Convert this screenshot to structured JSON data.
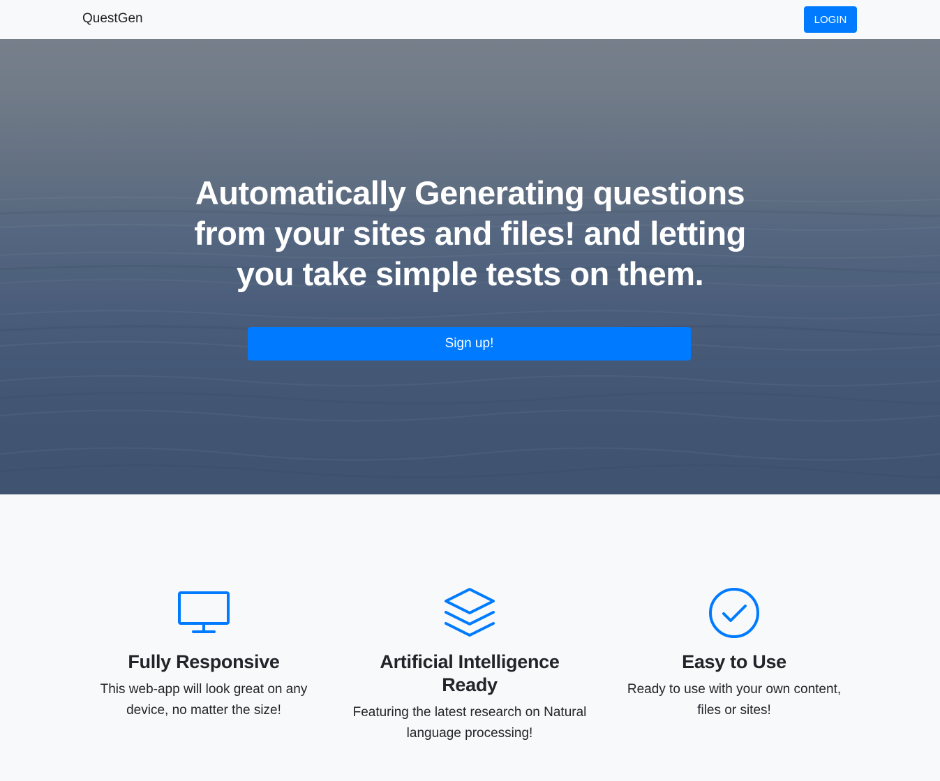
{
  "navbar": {
    "brand": "QuestGen",
    "login_label": "LOGIN"
  },
  "hero": {
    "title": "Automatically Generating questions from your sites and files! and letting you take simple tests on them.",
    "signup_label": "Sign up!"
  },
  "features": [
    {
      "icon": "monitor-icon",
      "title": "Fully Responsive",
      "text": "This web-app will look great on any device, no matter the size!"
    },
    {
      "icon": "layers-icon",
      "title": "Artificial Intelligence Ready",
      "text": "Featuring the latest research on Natural language processing!"
    },
    {
      "icon": "check-circle-icon",
      "title": "Easy to Use",
      "text": "Ready to use with your own content, files or sites!"
    }
  ],
  "colors": {
    "accent": "#007bff",
    "background": "#f8f9fa",
    "text": "#212529"
  }
}
